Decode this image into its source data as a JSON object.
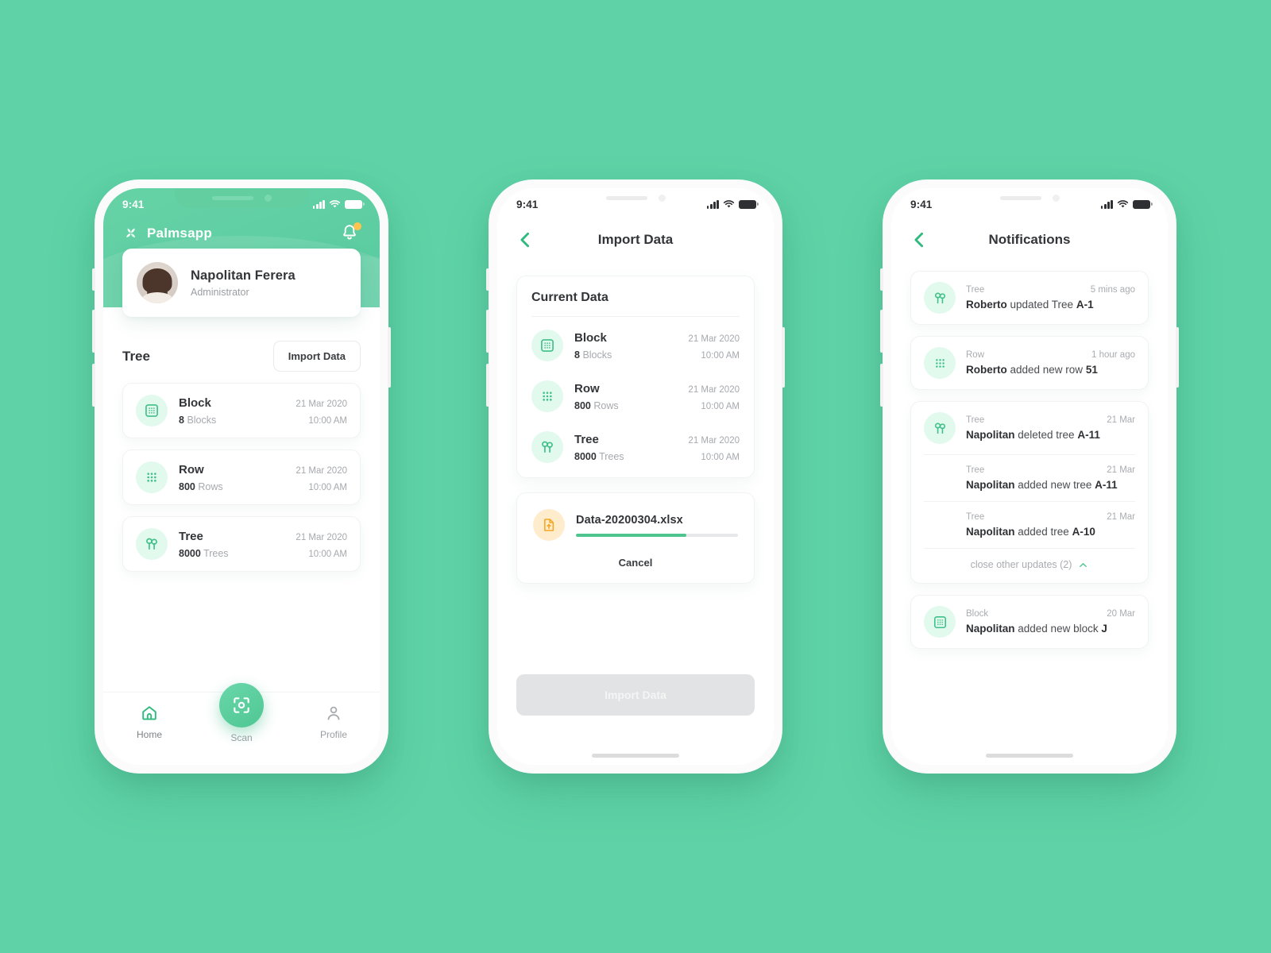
{
  "background_color": "#5fd3a7",
  "accent_color": "#4ec58f",
  "phones": {
    "home": {
      "status": {
        "time": "9:41",
        "signal_icon": "signal-bars-icon",
        "wifi_icon": "wifi-icon",
        "battery_icon": "battery-icon"
      },
      "appbar": {
        "logo_icon": "palm-leaf-logo-icon",
        "brand": "Palmsapp",
        "bell_icon": "bell-icon",
        "has_badge": true
      },
      "profile": {
        "name": "Napolitan Ferera",
        "role": "Administrator",
        "avatar_icon": "user-avatar-photo"
      },
      "section": {
        "title": "Tree",
        "import_label": "Import Data"
      },
      "items": [
        {
          "icon": "block-grid-icon",
          "title": "Block",
          "date": "21 Mar 2020",
          "count": "8",
          "unit": "Blocks",
          "time": "10:00 AM"
        },
        {
          "icon": "row-dots-icon",
          "title": "Row",
          "date": "21 Mar 2020",
          "count": "800",
          "unit": "Rows",
          "time": "10:00 AM"
        },
        {
          "icon": "tree-icon",
          "title": "Tree",
          "date": "21 Mar 2020",
          "count": "8000",
          "unit": "Trees",
          "time": "10:00 AM"
        }
      ],
      "tabs": [
        {
          "icon": "home-icon",
          "label": "Home",
          "active": true
        },
        {
          "icon": "scan-icon",
          "label": "Scan",
          "active": false
        },
        {
          "icon": "profile-person-icon",
          "label": "Profile",
          "active": false
        }
      ]
    },
    "import": {
      "status": {
        "time": "9:41"
      },
      "nav": {
        "back_icon": "chevron-left-icon",
        "title": "Import Data"
      },
      "panel": {
        "title": "Current Data"
      },
      "items": [
        {
          "icon": "block-grid-icon",
          "title": "Block",
          "date": "21 Mar 2020",
          "count": "8",
          "unit": "Blocks",
          "time": "10:00 AM"
        },
        {
          "icon": "row-dots-icon",
          "title": "Row",
          "date": "21 Mar 2020",
          "count": "800",
          "unit": "Rows",
          "time": "10:00 AM"
        },
        {
          "icon": "tree-icon",
          "title": "Tree",
          "date": "21 Mar 2020",
          "count": "8000",
          "unit": "Trees",
          "time": "10:00 AM"
        }
      ],
      "upload": {
        "file_icon": "file-upload-icon",
        "filename": "Data-20200304.xlsx",
        "progress_percent": 68,
        "cancel_label": "Cancel"
      },
      "submit": {
        "label": "Import Data",
        "disabled": true
      }
    },
    "notifications": {
      "status": {
        "time": "9:41"
      },
      "nav": {
        "back_icon": "chevron-left-icon",
        "title": "Notifications"
      },
      "cards": [
        {
          "icon": "tree-icon",
          "kind": "Tree",
          "time": "5 mins ago",
          "actor": "Roberto",
          "action": " updated Tree ",
          "target": "A-1",
          "sub_entries": [],
          "collapse": null
        },
        {
          "icon": "row-dots-icon",
          "kind": "Row",
          "time": "1 hour ago",
          "actor": "Roberto",
          "action": " added new row ",
          "target": "51",
          "sub_entries": [],
          "collapse": null
        },
        {
          "icon": "tree-icon",
          "kind": "Tree",
          "time": "21 Mar",
          "actor": "Napolitan",
          "action": " deleted tree ",
          "target": "A-11",
          "sub_entries": [
            {
              "kind": "Tree",
              "time": "21 Mar",
              "actor": "Napolitan",
              "action": " added new tree ",
              "target": "A-11"
            },
            {
              "kind": "Tree",
              "time": "21 Mar",
              "actor": "Napolitan",
              "action": " added tree ",
              "target": "A-10"
            }
          ],
          "collapse": {
            "label": "close other updates (2)",
            "icon": "chevron-up-icon"
          }
        },
        {
          "icon": "block-grid-icon",
          "kind": "Block",
          "time": "20 Mar",
          "actor": "Napolitan",
          "action": " added new block ",
          "target": "J",
          "sub_entries": [],
          "collapse": null
        }
      ]
    }
  }
}
